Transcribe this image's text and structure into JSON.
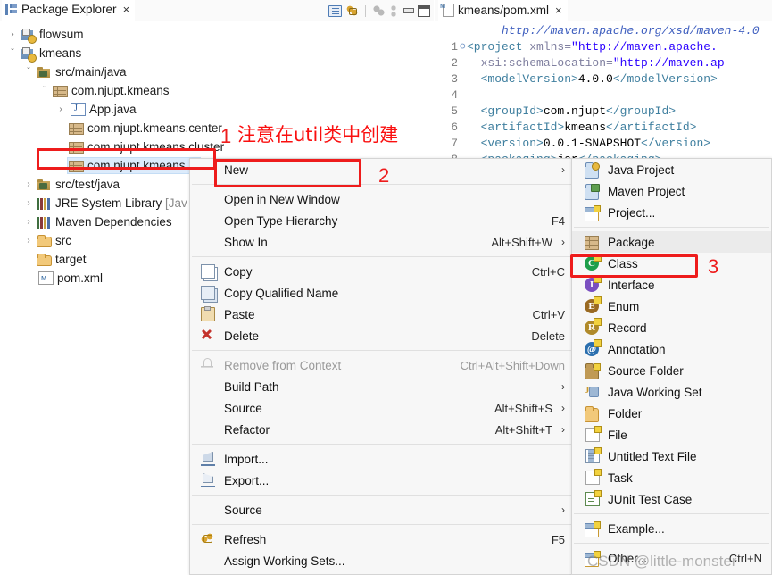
{
  "explorer": {
    "tab": {
      "title": "Package Explorer",
      "close": "×",
      "icon": "package-explorer-icon"
    },
    "toolbar": [
      {
        "name": "view-menu-icon"
      },
      {
        "name": "link-with-editor-icon"
      },
      {
        "name": "collapse-all-icon"
      },
      {
        "name": "link-icon"
      },
      {
        "name": "minimize-icon"
      },
      {
        "name": "maximize-icon"
      }
    ],
    "tree": [
      {
        "label": "flowsum",
        "indent": 0,
        "twist": "›",
        "icon": "java-project-icon",
        "selected": false
      },
      {
        "label": "kmeans",
        "indent": 0,
        "twist": "⌄",
        "icon": "java-project-icon",
        "selected": false
      },
      {
        "label": "src/main/java",
        "indent": 1,
        "twist": "⌄",
        "icon": "source-folder-icon",
        "selected": false
      },
      {
        "label": "com.njupt.kmeans",
        "indent": 2,
        "twist": "⌄",
        "icon": "package-icon",
        "selected": false
      },
      {
        "label": "App.java",
        "indent": 3,
        "twist": "›",
        "icon": "java-file-icon",
        "selected": false
      },
      {
        "label": "com.njupt.kmeans.center",
        "indent": 3,
        "twist": "",
        "icon": "package-icon",
        "selected": false
      },
      {
        "label": "com.njupt.kmeans.cluster",
        "indent": 3,
        "twist": "",
        "icon": "package-icon",
        "selected": false
      },
      {
        "label": "com.njupt.kmeans.u",
        "indent": 3,
        "twist": "",
        "icon": "package-icon",
        "selected": true
      },
      {
        "label": "src/test/java",
        "indent": 1,
        "twist": "›",
        "icon": "source-folder-icon",
        "selected": false
      },
      {
        "label": "JRE System Library ",
        "dim": "[Jav",
        "indent": 1,
        "twist": "›",
        "icon": "library-icon",
        "selected": false
      },
      {
        "label": "Maven Dependencies",
        "indent": 1,
        "twist": "›",
        "icon": "library-icon",
        "selected": false
      },
      {
        "label": "src",
        "indent": 1,
        "twist": "›",
        "icon": "folder-icon",
        "selected": false
      },
      {
        "label": "target",
        "indent": 1,
        "twist": "",
        "icon": "folder-icon",
        "selected": false
      },
      {
        "label": "pom.xml",
        "indent": 1,
        "twist": "",
        "icon": "xml-file-icon",
        "selected": false
      }
    ]
  },
  "editor": {
    "tab": {
      "title": "kmeans/pom.xml",
      "close": "×",
      "icon": "xml-file-icon"
    },
    "lines": [
      {
        "num": "",
        "fold": "",
        "segments": [
          {
            "t": "     http://maven.apache.org/xsd/maven-4.0",
            "c": "cmt"
          }
        ]
      },
      {
        "num": "1",
        "fold": "⊖",
        "segments": [
          {
            "t": "<project ",
            "c": "tag"
          },
          {
            "t": "xmlns=",
            "c": "attr"
          },
          {
            "t": "\"http://maven.apache.",
            "c": "str"
          }
        ]
      },
      {
        "num": "2",
        "fold": "",
        "segments": [
          {
            "t": "  xsi:schemaLocation=",
            "c": "attr"
          },
          {
            "t": "\"http://maven.ap",
            "c": "str"
          }
        ]
      },
      {
        "num": "3",
        "fold": "",
        "segments": [
          {
            "t": "  <modelVersion>",
            "c": "tag"
          },
          {
            "t": "4.0.0",
            "c": "txt"
          },
          {
            "t": "</modelVersion>",
            "c": "tag"
          }
        ]
      },
      {
        "num": "4",
        "fold": "",
        "segments": [
          {
            "t": "",
            "c": "txt"
          }
        ]
      },
      {
        "num": "5",
        "fold": "",
        "segments": [
          {
            "t": "  <groupId>",
            "c": "tag"
          },
          {
            "t": "com.njupt",
            "c": "txt"
          },
          {
            "t": "</groupId>",
            "c": "tag"
          }
        ]
      },
      {
        "num": "6",
        "fold": "",
        "segments": [
          {
            "t": "  <artifactId>",
            "c": "tag"
          },
          {
            "t": "kmeans",
            "c": "txt"
          },
          {
            "t": "</artifactId>",
            "c": "tag"
          }
        ]
      },
      {
        "num": "7",
        "fold": "",
        "segments": [
          {
            "t": "  <version>",
            "c": "tag"
          },
          {
            "t": "0.0.1-SNAPSHOT",
            "c": "txt"
          },
          {
            "t": "</version>",
            "c": "tag"
          }
        ]
      },
      {
        "num": "8",
        "fold": "",
        "segments": [
          {
            "t": "  <packaging>",
            "c": "tag"
          },
          {
            "t": "jar",
            "c": "txt"
          },
          {
            "t": "</packaging>",
            "c": "tag"
          }
        ]
      }
    ]
  },
  "context_menu": {
    "items": [
      {
        "label": "New",
        "key": "",
        "arrow": "›",
        "icon": "",
        "type": "item",
        "boxed": true
      },
      {
        "type": "separator"
      },
      {
        "label": "Open in New Window",
        "key": "",
        "arrow": "",
        "icon": "",
        "type": "item"
      },
      {
        "label": "Open Type Hierarchy",
        "key": "F4",
        "arrow": "",
        "icon": "",
        "type": "item"
      },
      {
        "label": "Show In",
        "key": "Alt+Shift+W",
        "arrow": "›",
        "icon": "",
        "type": "item"
      },
      {
        "type": "separator"
      },
      {
        "label": "Copy",
        "key": "Ctrl+C",
        "arrow": "",
        "icon": "copy-icon",
        "type": "item"
      },
      {
        "label": "Copy Qualified Name",
        "key": "",
        "arrow": "",
        "icon": "copy-qualified-name-icon",
        "type": "item"
      },
      {
        "label": "Paste",
        "key": "Ctrl+V",
        "arrow": "",
        "icon": "paste-icon",
        "type": "item"
      },
      {
        "label": "Delete",
        "key": "Delete",
        "arrow": "",
        "icon": "delete-icon",
        "type": "item"
      },
      {
        "type": "separator"
      },
      {
        "label": "Remove from Context",
        "key": "Ctrl+Alt+Shift+Down",
        "arrow": "",
        "icon": "remove-from-context-icon",
        "type": "item",
        "disabled": true
      },
      {
        "label": "Build Path",
        "key": "",
        "arrow": "›",
        "icon": "",
        "type": "item"
      },
      {
        "label": "Source",
        "key": "Alt+Shift+S",
        "arrow": "›",
        "icon": "",
        "type": "item"
      },
      {
        "label": "Refactor",
        "key": "Alt+Shift+T",
        "arrow": "›",
        "icon": "",
        "type": "item"
      },
      {
        "type": "separator"
      },
      {
        "label": "Import...",
        "key": "",
        "arrow": "",
        "icon": "import-icon",
        "type": "item"
      },
      {
        "label": "Export...",
        "key": "",
        "arrow": "",
        "icon": "export-icon",
        "type": "item"
      },
      {
        "type": "separator"
      },
      {
        "label": "Source",
        "key": "",
        "arrow": "›",
        "icon": "",
        "type": "item"
      },
      {
        "type": "separator"
      },
      {
        "label": "Refresh",
        "key": "F5",
        "arrow": "",
        "icon": "refresh-icon",
        "type": "item"
      },
      {
        "label": "Assign Working Sets...",
        "key": "",
        "arrow": "",
        "icon": "",
        "type": "item"
      }
    ]
  },
  "submenu": {
    "items": [
      {
        "label": "Java Project",
        "key": "",
        "icon": "java-project-icon",
        "type": "item"
      },
      {
        "label": "Maven Project",
        "key": "",
        "icon": "maven-project-icon",
        "type": "item"
      },
      {
        "label": "Project...",
        "key": "",
        "icon": "project-icon",
        "type": "item"
      },
      {
        "type": "separator"
      },
      {
        "label": "Package",
        "key": "",
        "icon": "package-icon",
        "type": "item",
        "hover": true
      },
      {
        "label": "Class",
        "key": "",
        "icon": "class-icon",
        "type": "item",
        "boxed": true
      },
      {
        "label": "Interface",
        "key": "",
        "icon": "interface-icon",
        "type": "item"
      },
      {
        "label": "Enum",
        "key": "",
        "icon": "enum-icon",
        "type": "item"
      },
      {
        "label": "Record",
        "key": "",
        "icon": "record-icon",
        "type": "item"
      },
      {
        "label": "Annotation",
        "key": "",
        "icon": "annotation-icon",
        "type": "item"
      },
      {
        "label": "Source Folder",
        "key": "",
        "icon": "source-folder-icon",
        "type": "item"
      },
      {
        "label": "Java Working Set",
        "key": "",
        "icon": "java-working-set-icon",
        "type": "item"
      },
      {
        "label": "Folder",
        "key": "",
        "icon": "folder-icon",
        "type": "item"
      },
      {
        "label": "File",
        "key": "",
        "icon": "file-icon",
        "type": "item"
      },
      {
        "label": "Untitled Text File",
        "key": "",
        "icon": "text-file-icon",
        "type": "item"
      },
      {
        "label": "Task",
        "key": "",
        "icon": "task-icon",
        "type": "item"
      },
      {
        "label": "JUnit Test Case",
        "key": "",
        "icon": "junit-test-case-icon",
        "type": "item"
      },
      {
        "type": "separator"
      },
      {
        "label": "Example...",
        "key": "",
        "icon": "example-icon",
        "type": "item"
      },
      {
        "type": "separator"
      },
      {
        "label": "Other...",
        "key": "Ctrl+N",
        "icon": "other-icon",
        "type": "item"
      }
    ]
  },
  "annotations": {
    "step1_number": "1",
    "step1_text": "注意在util类中创建",
    "step2_number": "2",
    "step3_number": "3",
    "highlight_color": "#ee1c1c"
  },
  "watermark": {
    "text": "CSDN @little-monster"
  }
}
